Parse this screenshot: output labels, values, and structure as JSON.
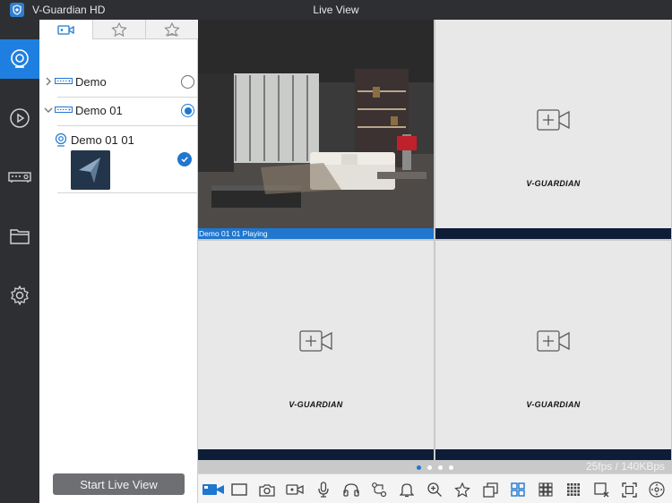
{
  "titlebar": {
    "app_name": "V-Guardian HD",
    "window_title": "Live View"
  },
  "nav": {
    "items": [
      {
        "name": "live-view",
        "active": true
      },
      {
        "name": "playback",
        "active": false
      },
      {
        "name": "devices",
        "active": false
      },
      {
        "name": "files",
        "active": false
      },
      {
        "name": "settings",
        "active": false
      }
    ],
    "accent": "#1f7fe0"
  },
  "panel": {
    "tabs": [
      "camera-tab",
      "favorites-tab",
      "group-tab"
    ],
    "devices": [
      {
        "label": "Demo",
        "expanded": false,
        "selected": false
      },
      {
        "label": "Demo 01",
        "expanded": true,
        "selected": true
      }
    ],
    "camera": {
      "label": "Demo 01 01",
      "checked": true
    },
    "start_button": "Start Live View"
  },
  "grid": {
    "cells": [
      {
        "status": "Demo 01 01  Playing",
        "playing": true
      },
      {
        "brand": "V-GUARDIAN",
        "playing": false
      },
      {
        "brand": "V-GUARDIAN",
        "playing": false
      },
      {
        "brand": "V-GUARDIAN",
        "playing": false
      }
    ]
  },
  "pager": {
    "pages": 4,
    "current": 1
  },
  "stats": {
    "fps": "25fps / 140KBps"
  },
  "toolbar": {
    "items": [
      "live-camera",
      "window",
      "snapshot",
      "record",
      "microphone",
      "audio",
      "ptz-route",
      "alarm",
      "zoom",
      "favorite",
      "copy",
      "layout-4",
      "layout-9",
      "layout-16",
      "close-window",
      "fullscreen",
      "ptz-control"
    ],
    "active": "layout-4"
  }
}
